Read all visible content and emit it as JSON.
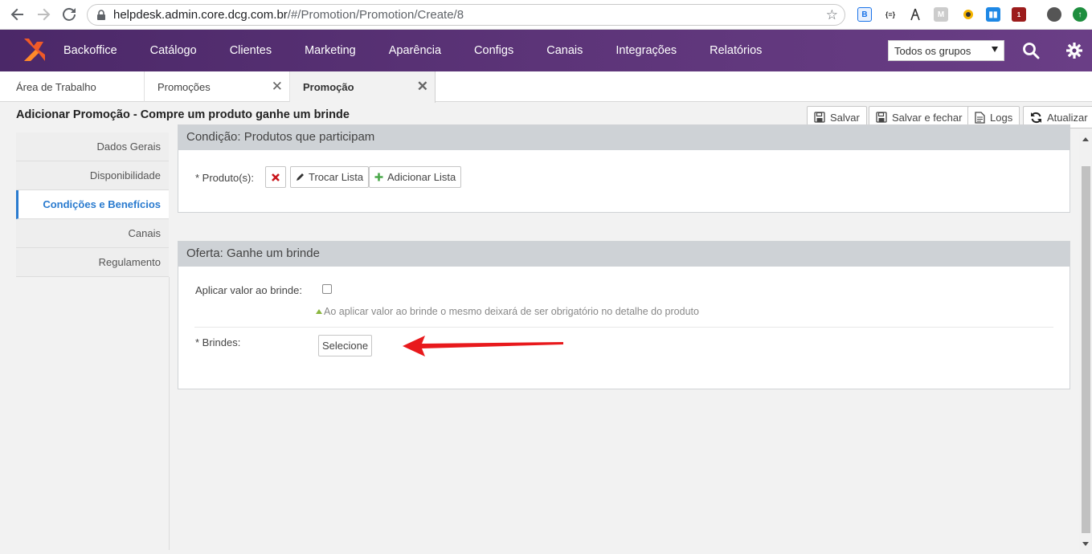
{
  "browser": {
    "url_host": "helpdesk.admin.core.dcg.com.br",
    "url_path": "/#/Promotion/Promotion/Create/8"
  },
  "topnav": {
    "menu": [
      "Backoffice",
      "Catálogo",
      "Clientes",
      "Marketing",
      "Aparência",
      "Configs",
      "Canais",
      "Integrações",
      "Relatórios"
    ],
    "group_select": "Todos os grupos"
  },
  "tabs": [
    {
      "label": "Área de Trabalho"
    },
    {
      "label": "Promoções"
    },
    {
      "label": "Promoção"
    }
  ],
  "page": {
    "title": "Adicionar Promoção - Compre um produto ganhe um brinde",
    "buttons": {
      "save": "Salvar",
      "save_close": "Salvar e fechar",
      "logs": "Logs",
      "refresh": "Atualizar"
    }
  },
  "leftnav": [
    "Dados Gerais",
    "Disponibilidade",
    "Condições e Benefícios",
    "Canais",
    "Regulamento"
  ],
  "condition_panel": {
    "title": "Condição: Produtos que participam",
    "products_label": "* Produto(s):",
    "swap_list": "Trocar Lista",
    "add_list": "Adicionar Lista"
  },
  "offer_panel": {
    "title": "Oferta: Ganhe um brinde",
    "apply_value_label": "Aplicar valor ao brinde:",
    "hint": "Ao aplicar valor ao brinde o mesmo deixará de ser obrigatório no detalhe do produto",
    "gifts_label": "* Brindes:",
    "select_button": "Selecione"
  },
  "colors": {
    "nav_purple": "#5c3478",
    "active_blue": "#2a7bcf",
    "panel_head": "#ced2d6",
    "annotation_red": "#e8191c"
  }
}
